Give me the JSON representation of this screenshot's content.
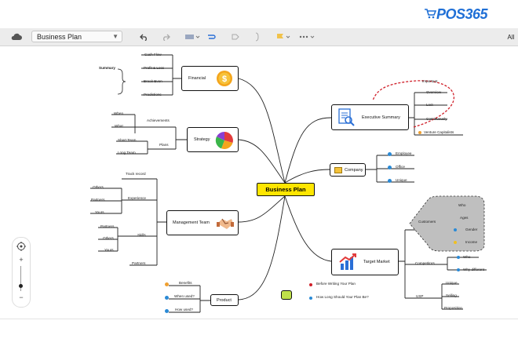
{
  "brand": {
    "logo_text": "POS365",
    "color": "#1f6fd6"
  },
  "toolbar": {
    "doc_title": "Business Plan",
    "right_label": "All"
  },
  "mindmap": {
    "central": "Business Plan",
    "financial": {
      "label": "Financial",
      "summary": "Summary",
      "items": [
        "Cash Flow",
        "Profit & Loss",
        "Break Even",
        "Predictions"
      ]
    },
    "strategy": {
      "label": "Strategy",
      "achievements": "Achievements",
      "when": "When",
      "what": "What",
      "plans": "Plans",
      "short_team": "Short Team",
      "long_team": "Long Team"
    },
    "management": {
      "label": "Management Team",
      "track_record": "Track record",
      "experience": "Experience",
      "skills": "Skills",
      "partners": "Partners",
      "others": "Others",
      "yours": "Yours"
    },
    "product": {
      "label": "Product",
      "items": [
        "Benefits",
        "When used?",
        "How used?"
      ]
    },
    "product_links": [
      "Before Writing Your Plan",
      "How Long Should Your Plan Be?"
    ],
    "executive": {
      "label": "Executive Summary",
      "important": "Important",
      "items": [
        "Overview",
        "Lost",
        "Continuously",
        "Venture Capitalists"
      ]
    },
    "company": {
      "label": "Company",
      "items": [
        "Employee",
        "Office",
        "Unique"
      ]
    },
    "target": {
      "label": "Target Market",
      "customers": "Customers",
      "customer_items": [
        "Who",
        "Ages",
        "Gender",
        "Income"
      ],
      "competitors": "Competitors",
      "competitor_items": [
        "Who",
        "Why different"
      ],
      "usp": "USP",
      "usp_items": [
        "Unique",
        "Selling",
        "Proposition"
      ]
    }
  },
  "colors": {
    "central": "#ffe600",
    "dashed_red": "#d0202a",
    "highlight": "#bfbfbf"
  }
}
